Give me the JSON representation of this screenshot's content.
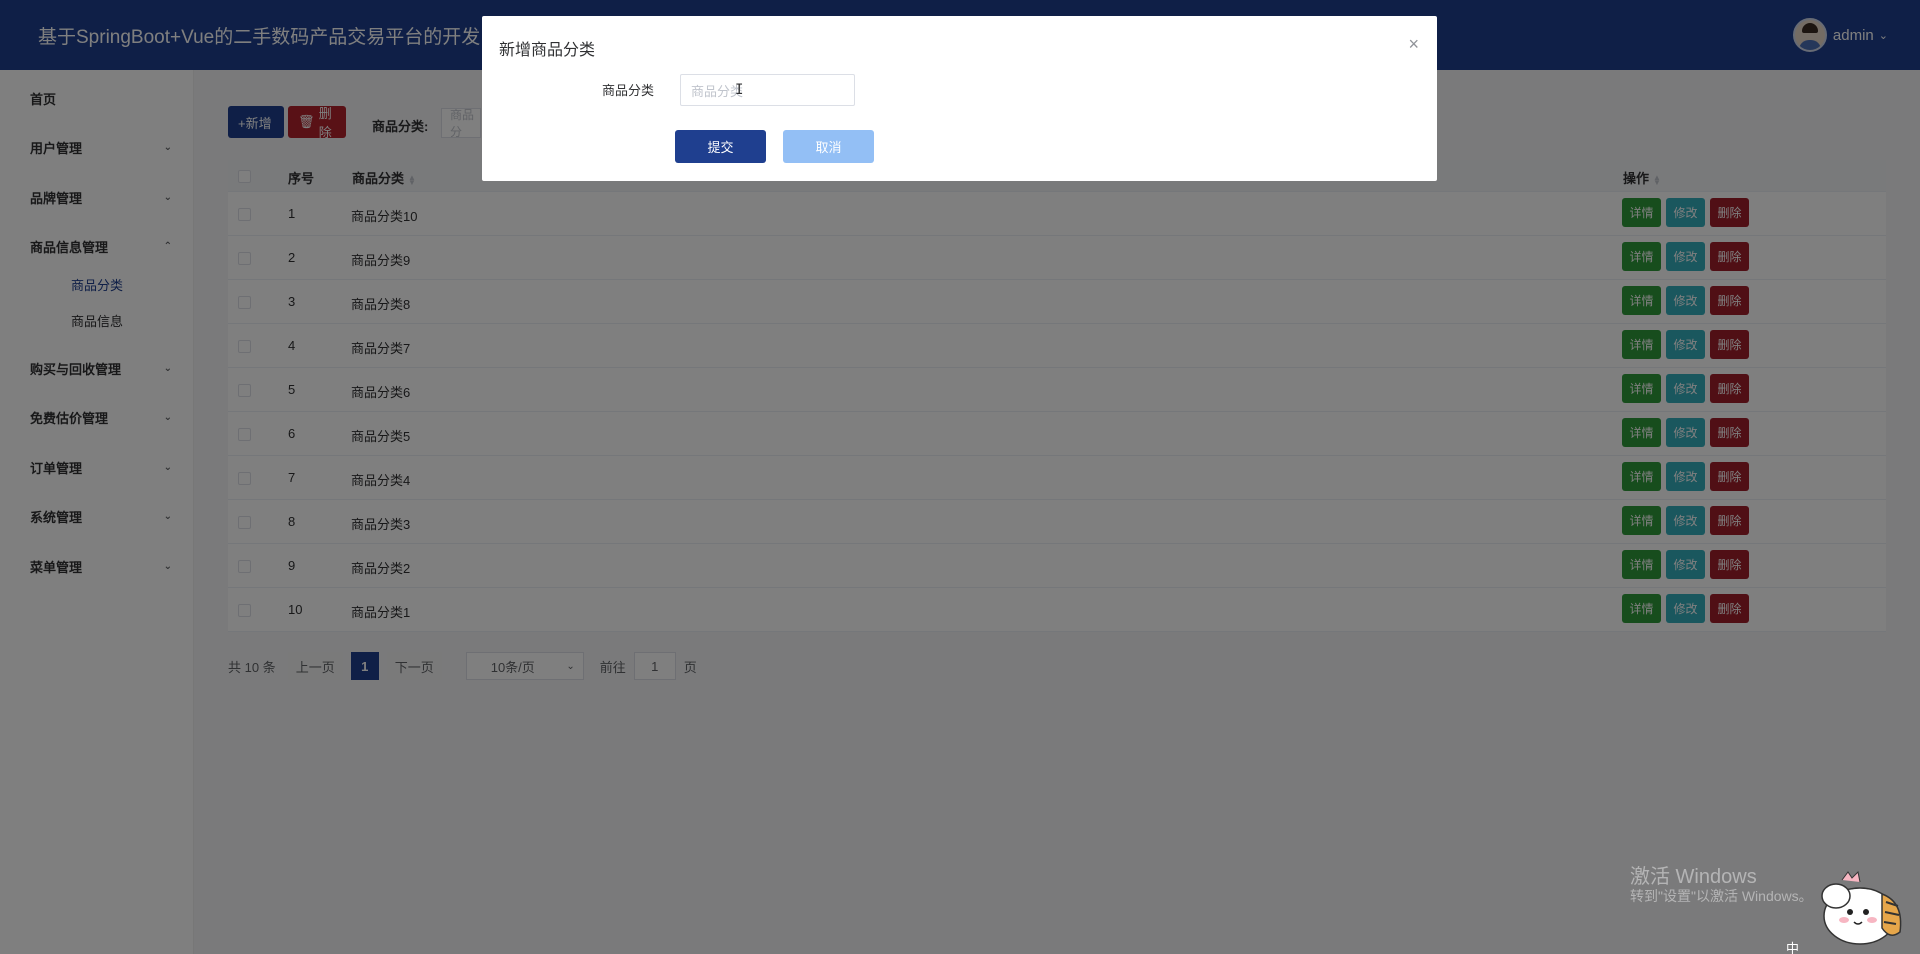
{
  "header": {
    "title": "基于SpringBoot+Vue的二手数码产品交易平台的开发",
    "username": "admin"
  },
  "sidebar": {
    "items": [
      {
        "label": "首页",
        "expandable": false
      },
      {
        "label": "用户管理",
        "expandable": true
      },
      {
        "label": "品牌管理",
        "expandable": true
      },
      {
        "label": "商品信息管理",
        "expandable": true,
        "expanded": true,
        "children": [
          {
            "label": "商品分类",
            "active": true
          },
          {
            "label": "商品信息",
            "active": false
          }
        ]
      },
      {
        "label": "购买与回收管理",
        "expandable": true
      },
      {
        "label": "免费估价管理",
        "expandable": true
      },
      {
        "label": "订单管理",
        "expandable": true
      },
      {
        "label": "系统管理",
        "expandable": true
      },
      {
        "label": "菜单管理",
        "expandable": true
      }
    ]
  },
  "toolbar": {
    "add_label": "+新增",
    "delete_label": "删除",
    "filter_label": "商品分类:",
    "filter_placeholder": "商品分"
  },
  "table": {
    "columns": [
      "序号",
      "商品分类",
      "操作"
    ],
    "rows": [
      {
        "index": "1",
        "category": "商品分类10"
      },
      {
        "index": "2",
        "category": "商品分类9"
      },
      {
        "index": "3",
        "category": "商品分类8"
      },
      {
        "index": "4",
        "category": "商品分类7"
      },
      {
        "index": "5",
        "category": "商品分类6"
      },
      {
        "index": "6",
        "category": "商品分类5"
      },
      {
        "index": "7",
        "category": "商品分类4"
      },
      {
        "index": "8",
        "category": "商品分类3"
      },
      {
        "index": "9",
        "category": "商品分类2"
      },
      {
        "index": "10",
        "category": "商品分类1"
      }
    ],
    "actions": {
      "detail": "详情",
      "edit": "修改",
      "delete": "删除"
    }
  },
  "pagination": {
    "total": "共 10 条",
    "prev": "上一页",
    "current": "1",
    "next": "下一页",
    "page_size": "10条/页",
    "goto_label": "前往",
    "goto_value": "1",
    "page_unit": "页"
  },
  "dialog": {
    "title": "新增商品分类",
    "field_label": "商品分类",
    "field_placeholder": "商品分类",
    "submit": "提交",
    "cancel": "取消"
  },
  "watermark": {
    "line1": "激活 Windows",
    "line2": "转到\"设置\"以激活 Windows。",
    "ime": "中"
  },
  "colors": {
    "primary": "#1f3f8f",
    "danger": "#b3222c",
    "success": "#2e9b3a",
    "info": "#35aebd",
    "cancel": "#93bff5"
  }
}
